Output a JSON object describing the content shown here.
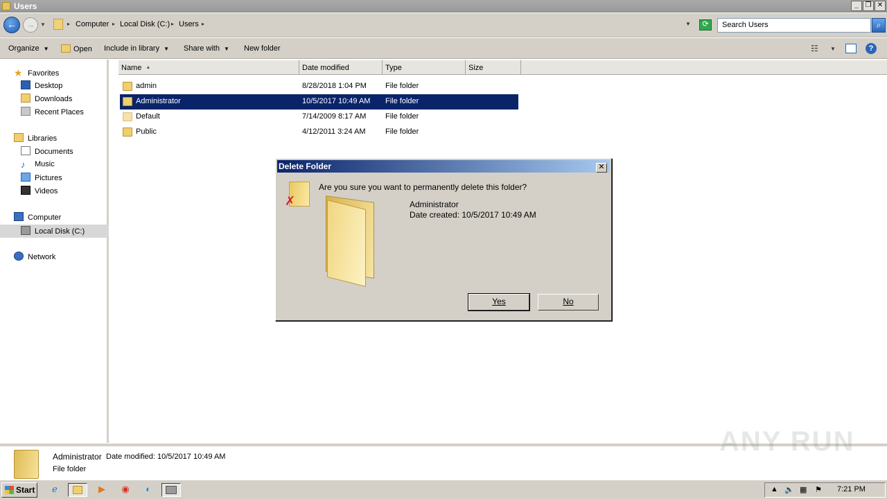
{
  "window": {
    "title": "Users"
  },
  "address": {
    "crumbs": [
      "Computer",
      "Local Disk (C:)",
      "Users"
    ],
    "search_placeholder": "Search Users"
  },
  "toolbar": {
    "organize": "Organize",
    "open": "Open",
    "include_in_library": "Include in library",
    "share_with": "Share with",
    "new_folder": "New folder"
  },
  "nav": {
    "favorites": "Favorites",
    "desktop": "Desktop",
    "downloads": "Downloads",
    "recent_places": "Recent Places",
    "libraries": "Libraries",
    "documents": "Documents",
    "music": "Music",
    "pictures": "Pictures",
    "videos": "Videos",
    "computer": "Computer",
    "local_disk": "Local Disk (C:)",
    "network": "Network"
  },
  "columns": {
    "name": "Name",
    "date_modified": "Date modified",
    "type": "Type",
    "size": "Size"
  },
  "files": [
    {
      "name": "admin",
      "date": "8/28/2018 1:04 PM",
      "type": "File folder"
    },
    {
      "name": "Administrator",
      "date": "10/5/2017 10:49 AM",
      "type": "File folder"
    },
    {
      "name": "Default",
      "date": "7/14/2009 8:17 AM",
      "type": "File folder"
    },
    {
      "name": "Public",
      "date": "4/12/2011 3:24 AM",
      "type": "File folder"
    }
  ],
  "details": {
    "name": "Administrator",
    "date_label": "Date modified: 10/5/2017 10:49 AM",
    "type": "File folder"
  },
  "dialog": {
    "title": "Delete Folder",
    "message": "Are you sure you want to permanently delete this folder?",
    "item_name": "Administrator",
    "item_created": "Date created: 10/5/2017 10:49 AM",
    "yes_label": "Yes",
    "no_label": "No"
  },
  "taskbar": {
    "start_label": "Start",
    "clock": "7:21 PM"
  },
  "watermark": "ANY RUN",
  "colors": {
    "selection": "#0a246a",
    "accent": "#1b5cb5"
  }
}
